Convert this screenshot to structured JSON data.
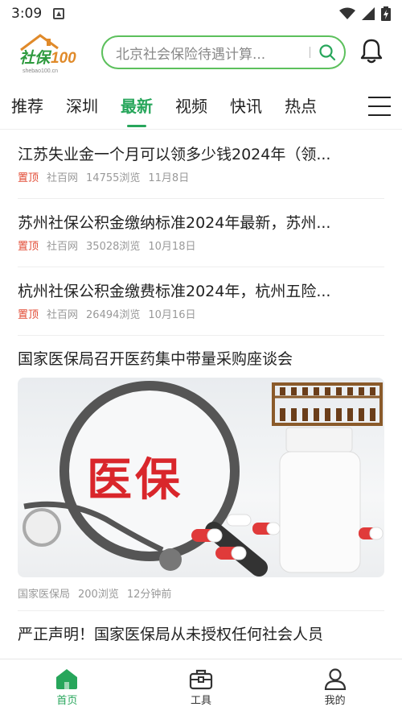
{
  "status_bar": {
    "time": "3:09"
  },
  "header": {
    "logo_text": "社保100",
    "logo_subtext": "shebao100.cn",
    "search_placeholder": "北京社会保险待遇计算..."
  },
  "tabs": [
    {
      "label": "推荐"
    },
    {
      "label": "深圳"
    },
    {
      "label": "最新"
    },
    {
      "label": "视频"
    },
    {
      "label": "快讯"
    },
    {
      "label": "热点"
    }
  ],
  "active_tab": "最新",
  "news": [
    {
      "title": "江苏失业金一个月可以领多少钱2024年（领...",
      "tag": "置顶",
      "source": "社百网",
      "views": "14755浏览",
      "date": "11月8日"
    },
    {
      "title": "苏州社保公积金缴纳标准2024年最新，苏州...",
      "tag": "置顶",
      "source": "社百网",
      "views": "35028浏览",
      "date": "10月18日"
    },
    {
      "title": "杭州社保公积金缴费标准2024年，杭州五险...",
      "tag": "置顶",
      "source": "社百网",
      "views": "26494浏览",
      "date": "10月16日"
    }
  ],
  "feature": {
    "title": "国家医保局召开医药集中带量采购座谈会",
    "image_text": "医保",
    "source": "国家医保局",
    "views": "200浏览",
    "time": "12分钟前"
  },
  "next_title": "严正声明！国家医保局从未授权任何社会人员",
  "bottom_nav": [
    {
      "label": "首页"
    },
    {
      "label": "工具"
    },
    {
      "label": "我的"
    }
  ],
  "colors": {
    "accent": "#27a65b",
    "pin": "#e24b35",
    "search_border": "#5cc05c"
  }
}
